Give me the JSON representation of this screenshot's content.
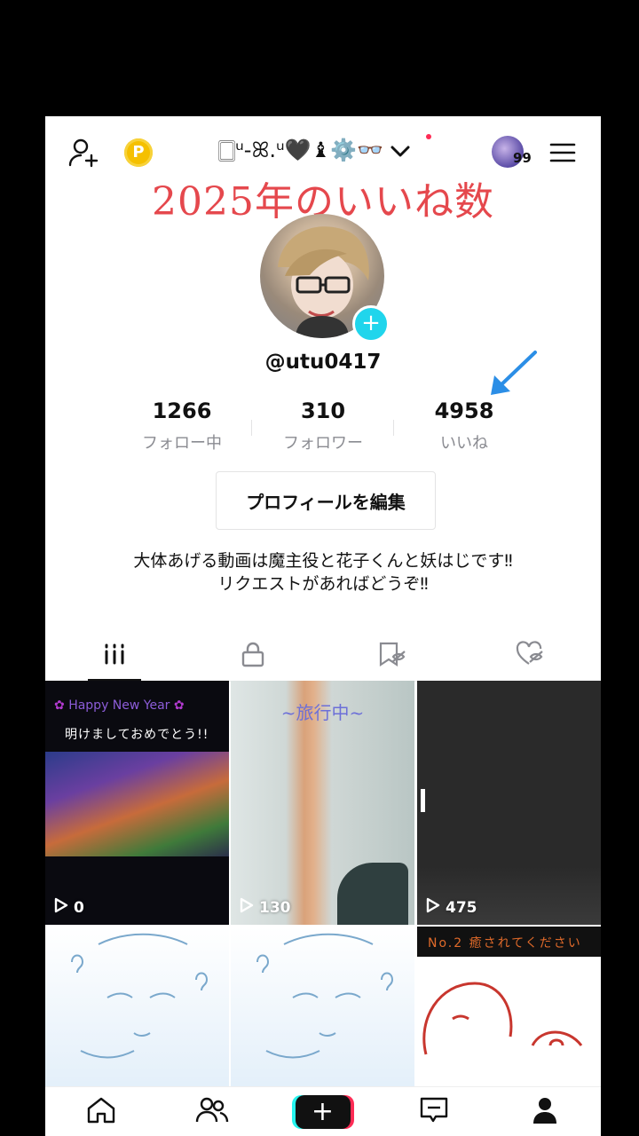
{
  "header": {
    "coin_label": "P",
    "display_name": "🀆ᵘ-ꕤ.ᵘ🖤♝⚙️👓",
    "avatar_badge": "99"
  },
  "overlay_caption": "2025年のいいね数",
  "profile": {
    "handle": "@utu0417",
    "avatar_plus": "+",
    "stats": [
      {
        "value": "1266",
        "label": "フォロー中"
      },
      {
        "value": "310",
        "label": "フォロワー"
      },
      {
        "value": "4958",
        "label": "いいね"
      }
    ],
    "edit_button": "プロフィールを編集",
    "bio_line1": "大体あげる動画は魔主役と花子くんと妖はじです‼",
    "bio_line2": "リクエストがあればどうぞ‼"
  },
  "videos": [
    {
      "views": "0",
      "caption_top": "Happy New Year",
      "caption_sub": "明けましておめでとう!!"
    },
    {
      "views": "130",
      "caption_top": "~旅行中~"
    },
    {
      "views": "475"
    },
    {
      "views": ""
    },
    {
      "views": ""
    },
    {
      "views": "",
      "caption_top": "No.2 癒されてください"
    }
  ],
  "bottom_nav": {
    "plus": "+"
  },
  "colors": {
    "accent_cyan": "#20d5ec",
    "accent_red": "#fe2c55",
    "caption_red": "#e5484d",
    "arrow_blue": "#2b8ee6"
  }
}
